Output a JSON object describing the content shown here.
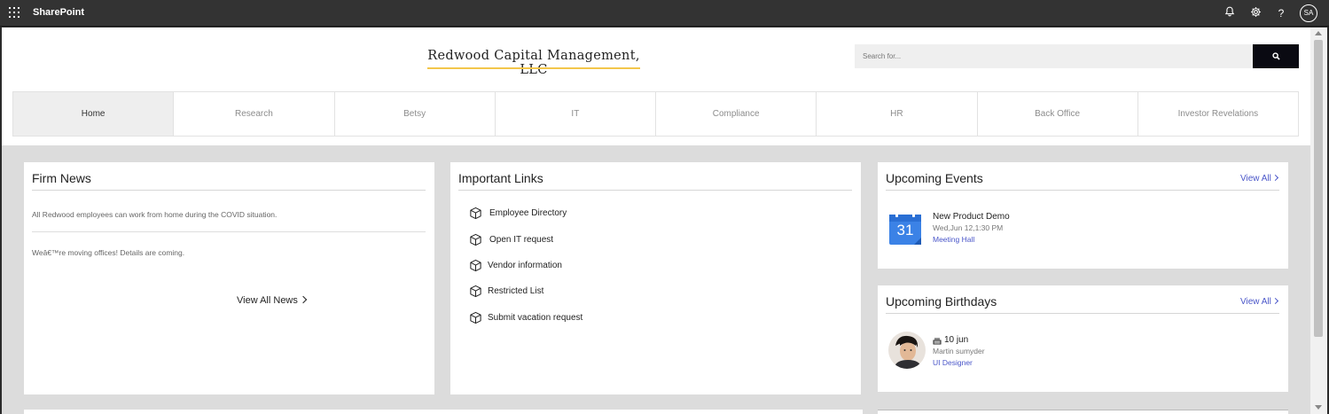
{
  "suitebar": {
    "app_name": "SharePoint",
    "icons": [
      "waffle-icon",
      "bell-icon",
      "gear-icon",
      "help-icon"
    ],
    "help_glyph": "?",
    "avatar_initials": "SA"
  },
  "header": {
    "site_title": "Redwood Capital Management, LLC",
    "accent_color": "#f3c64b",
    "search": {
      "placeholder": "Search for..."
    }
  },
  "nav": {
    "items": [
      {
        "label": "Home",
        "active": true
      },
      {
        "label": "Research"
      },
      {
        "label": "Betsy"
      },
      {
        "label": "IT"
      },
      {
        "label": "Compliance"
      },
      {
        "label": "HR"
      },
      {
        "label": "Back Office"
      },
      {
        "label": "Investor Revelations"
      }
    ]
  },
  "firm_news": {
    "title": "Firm News",
    "items": [
      "All Redwood employees can work from home during the COVID situation.",
      "Weâ€™re moving offices! Details are coming."
    ],
    "view_all_label": "View All News"
  },
  "important_links": {
    "title": "Important Links",
    "links": [
      "Employee Directory",
      "Open IT request",
      "Vendor information",
      "Restricted List",
      "Submit vacation request"
    ]
  },
  "upcoming_events": {
    "title": "Upcoming Events",
    "view_all_label": "View All",
    "event": {
      "calendar_day": "31",
      "title": "New Product Demo",
      "date": "Wed,Jun 12,1:30 PM",
      "location": "Meeting Hall"
    }
  },
  "upcoming_birthdays": {
    "title": "Upcoming Birthdays",
    "view_all_label": "View All",
    "person": {
      "date": "10 jun",
      "name": "Martin sumyder",
      "role": "UI Designer"
    }
  },
  "colors": {
    "link_blue": "#4a56c9",
    "page_bg": "#dcdcdc",
    "suitebar_bg": "#333333",
    "search_button_bg": "#0a0a12"
  }
}
